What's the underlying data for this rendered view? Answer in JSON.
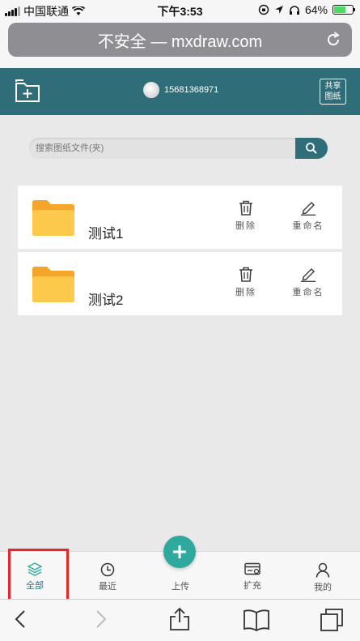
{
  "status_bar": {
    "carrier": "中国联通",
    "time": "下午3:53",
    "battery": "64%",
    "battery_level": 0.64
  },
  "browser": {
    "address": "不安全 — mxdraw.com",
    "icons": [
      "reload-icon",
      "back-icon",
      "forward-icon",
      "share-icon",
      "bookmarks-icon",
      "tabs-icon"
    ]
  },
  "header": {
    "phone": "15681368971",
    "share_label_line1": "共享",
    "share_label_line2": "图纸"
  },
  "search": {
    "placeholder": "搜索图纸文件(夹)"
  },
  "files": [
    {
      "name": "测试1",
      "delete_label": "删除",
      "rename_label": "重命名"
    },
    {
      "name": "测试2",
      "delete_label": "删除",
      "rename_label": "重命名"
    }
  ],
  "tabs": {
    "all": "全部",
    "recent": "最近",
    "upload": "上传",
    "expand": "扩充",
    "mine": "我的"
  },
  "colors": {
    "accent": "#2f6e79",
    "fab": "#2fa89d",
    "folder": "#f9b233",
    "highlight": "#e8262b"
  }
}
